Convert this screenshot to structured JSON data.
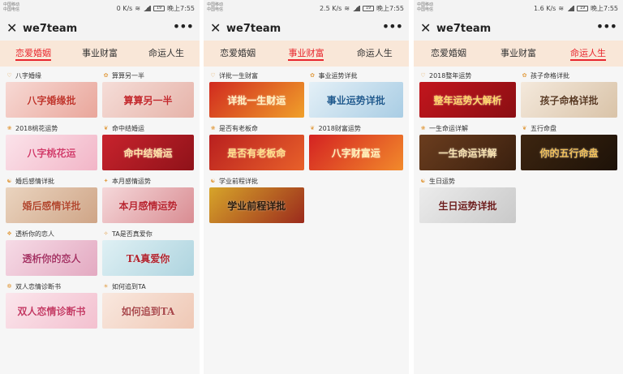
{
  "screens": [
    {
      "status": {
        "carrier1": "中国移动",
        "carrier2": "中国电信",
        "speed": "0 K/s",
        "time": "晚上7:55",
        "battery": "19"
      },
      "title": "we7team",
      "tabs": [
        "恋爱婚姻",
        "事业财富",
        "命运人生"
      ],
      "active_tab": 0,
      "items": [
        {
          "label": "八字婚缘",
          "banner": "八字婚缘批",
          "colors": [
            "#f7d9d4",
            "#e9a69b"
          ],
          "text_color": "#c0342a"
        },
        {
          "label": "算算另一半",
          "banner": "算算另一半",
          "colors": [
            "#f5ddd8",
            "#e6b3a9"
          ],
          "text_color": "#c3282c"
        },
        {
          "label": "2018桃花运势",
          "banner": "八字桃花运",
          "colors": [
            "#fbe3ea",
            "#f2b5c7"
          ],
          "text_color": "#d23b6a"
        },
        {
          "label": "命中结婚运",
          "banner": "命中结婚运",
          "colors": [
            "#c8232d",
            "#8f1219"
          ],
          "text_color": "#ffe3a6"
        },
        {
          "label": "婚后感情详批",
          "banner": "婚后感情详批",
          "colors": [
            "#ead4bf",
            "#cfa587"
          ],
          "text_color": "#b2482e"
        },
        {
          "label": "本月感情运势",
          "banner": "本月感情运势",
          "colors": [
            "#f5d8da",
            "#d98c92"
          ],
          "text_color": "#b8242f"
        },
        {
          "label": "透析你的恋人",
          "banner": "透析你的恋人",
          "colors": [
            "#f6dbe6",
            "#e3a9c1"
          ],
          "text_color": "#a73566"
        },
        {
          "label": "TA是否真爱你",
          "banner": "TA真爱你",
          "colors": [
            "#dff0f4",
            "#aed4df"
          ],
          "text_color": "#b2242f"
        },
        {
          "label": "双人恋情诊断书",
          "banner": "双人恋情诊断书",
          "colors": [
            "#fbe6ec",
            "#f3c0cf"
          ],
          "text_color": "#c53a64"
        },
        {
          "label": "如何追到TA",
          "banner": "如何追到TA",
          "colors": [
            "#f9e8df",
            "#efc8b5"
          ],
          "text_color": "#a9484a"
        }
      ]
    },
    {
      "status": {
        "carrier1": "中国移动",
        "carrier2": "中国电信",
        "speed": "2.5 K/s",
        "time": "晚上7:55",
        "battery": "19"
      },
      "title": "we7team",
      "tabs": [
        "恋爱婚姻",
        "事业财富",
        "命运人生"
      ],
      "active_tab": 1,
      "items": [
        {
          "label": "详批一生财富",
          "banner": "详批一生财运",
          "colors": [
            "#d12a1f",
            "#f0a02a"
          ],
          "text_color": "#fff3c4"
        },
        {
          "label": "事业运势详批",
          "banner": "事业运势详批",
          "colors": [
            "#e4f0f7",
            "#a9cde4"
          ],
          "text_color": "#1f5a8e"
        },
        {
          "label": "是否有老板命",
          "banner": "是否有老板命",
          "colors": [
            "#b91f1f",
            "#e8612a"
          ],
          "text_color": "#ffe08a"
        },
        {
          "label": "2018财富运势",
          "banner": "八字财富运",
          "colors": [
            "#d42222",
            "#f28a2b"
          ],
          "text_color": "#fff2b8"
        },
        {
          "label": "学业前程详批",
          "banner": "学业前程详批",
          "colors": [
            "#d7a52a",
            "#9b2a1c"
          ],
          "text_color": "#2a1a0c"
        }
      ]
    },
    {
      "status": {
        "carrier1": "中国移动",
        "carrier2": "中国电信",
        "speed": "1.6 K/s",
        "time": "晚上7:55",
        "battery": "19"
      },
      "title": "we7team",
      "tabs": [
        "恋爱婚姻",
        "事业财富",
        "命运人生"
      ],
      "active_tab": 2,
      "items": [
        {
          "label": "2018整年运势",
          "banner": "整年运势大解析",
          "colors": [
            "#c2161d",
            "#8b0e13"
          ],
          "text_color": "#ffd86b"
        },
        {
          "label": "孩子命格详批",
          "banner": "孩子命格详批",
          "colors": [
            "#f4e9dc",
            "#d9c3a8"
          ],
          "text_color": "#5a3a22"
        },
        {
          "label": "一生命运详解",
          "banner": "一生命运详解",
          "colors": [
            "#6b3d1e",
            "#3a200f"
          ],
          "text_color": "#f8e2b0"
        },
        {
          "label": "五行命盘",
          "banner": "你的五行命盘",
          "colors": [
            "#3d2510",
            "#1d1208"
          ],
          "text_color": "#f2c15a"
        },
        {
          "label": "生日运势",
          "banner": "生日运势详批",
          "colors": [
            "#ececec",
            "#c9c9c9"
          ],
          "text_color": "#6b1b1b"
        }
      ]
    }
  ]
}
